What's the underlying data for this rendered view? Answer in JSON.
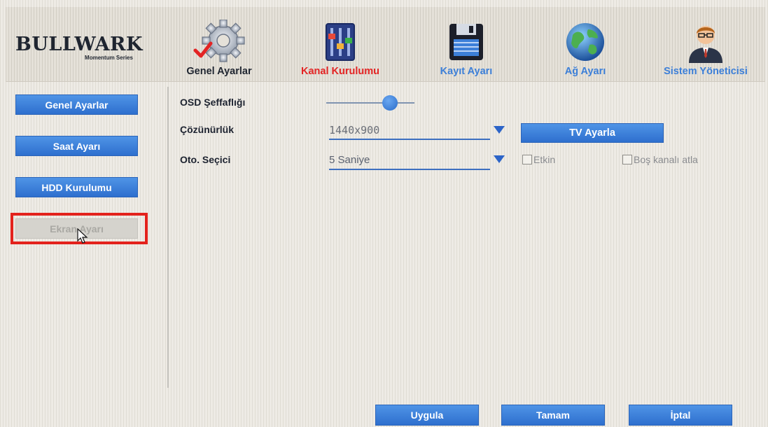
{
  "brand": {
    "name": "BULLWARK",
    "sub": "Momentum Series"
  },
  "tabs": [
    {
      "label": "Genel Ayarlar",
      "icon": "gear-check-icon",
      "state": "normal"
    },
    {
      "label": "Kanal Kurulumu",
      "icon": "mixer-icon",
      "state": "active"
    },
    {
      "label": "Kayıt Ayarı",
      "icon": "floppy-disk-icon",
      "state": "normal"
    },
    {
      "label": "Ağ Ayarı",
      "icon": "globe-icon",
      "state": "normal"
    },
    {
      "label": "Sistem Yöneticisi",
      "icon": "admin-user-icon",
      "state": "normal"
    }
  ],
  "sidebar": {
    "items": [
      {
        "label": "Genel Ayarlar",
        "enabled": true
      },
      {
        "label": "Saat Ayarı",
        "enabled": true
      },
      {
        "label": "HDD Kurulumu",
        "enabled": true
      },
      {
        "label": "Ekran Ayarı",
        "enabled": false
      }
    ]
  },
  "form": {
    "osd_label": "OSD Şeffaflığı",
    "osd_value": 0.72,
    "resolution_label": "Çözünürlük",
    "resolution_value": "1440x900",
    "tv_button": "TV Ayarla",
    "auto_label": "Oto. Seçici",
    "auto_value": "5 Saniye",
    "enable_label": "Etkin",
    "enable_checked": false,
    "skip_label": "Boş kanalı atla",
    "skip_checked": false
  },
  "footer": {
    "apply": "Uygula",
    "ok": "Tamam",
    "cancel": "İptal"
  },
  "colors": {
    "accent": "#3a7fda",
    "active_tab": "#e32424",
    "highlight": "#e3221c"
  }
}
